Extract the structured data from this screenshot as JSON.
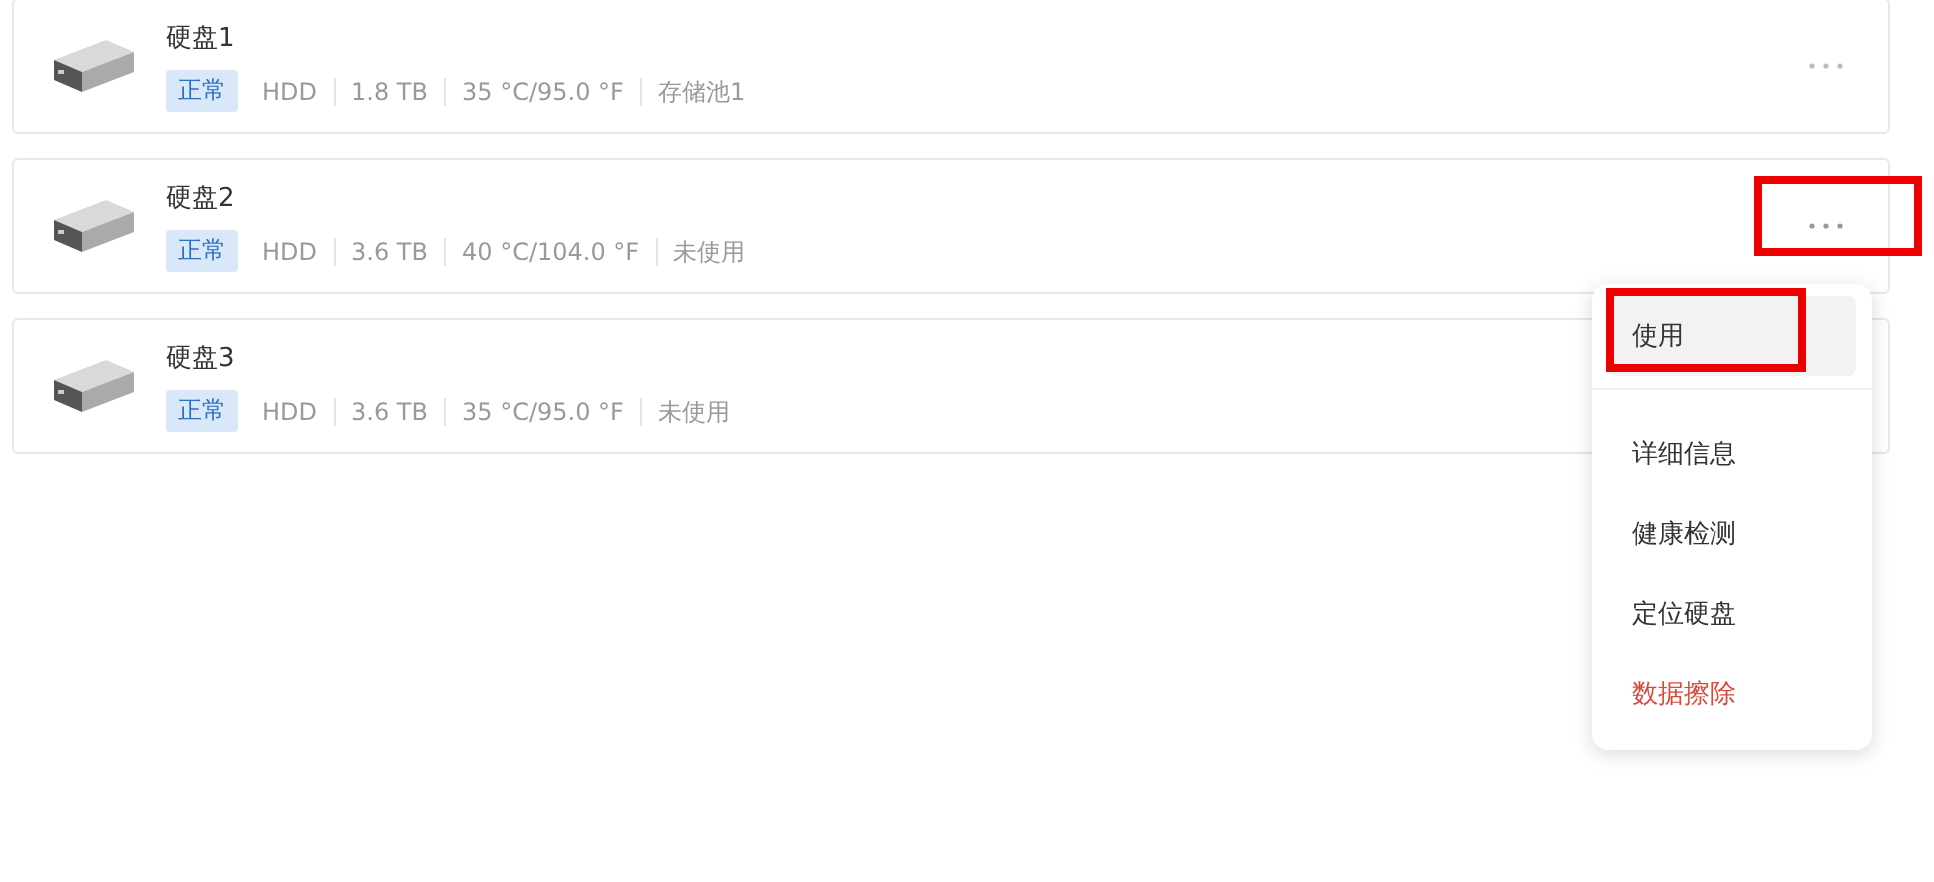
{
  "disks": [
    {
      "name": "硬盘1",
      "status": "正常",
      "type": "HDD",
      "capacity": "1.8 TB",
      "temperature": "35 °C/95.0 °F",
      "usage": "存储池1",
      "menu_open": false,
      "annotated": false
    },
    {
      "name": "硬盘2",
      "status": "正常",
      "type": "HDD",
      "capacity": "3.6 TB",
      "temperature": "40 °C/104.0 °F",
      "usage": "未使用",
      "menu_open": true,
      "annotated": true
    },
    {
      "name": "硬盘3",
      "status": "正常",
      "type": "HDD",
      "capacity": "3.6 TB",
      "temperature": "35 °C/95.0 °F",
      "usage": "未使用",
      "menu_open": false,
      "annotated": false
    }
  ],
  "menu": {
    "groups": [
      {
        "items": [
          {
            "label": "使用",
            "kind": "normal",
            "hovered": true,
            "annotated": true
          }
        ]
      },
      {
        "items": [
          {
            "label": "详细信息",
            "kind": "normal",
            "hovered": false,
            "annotated": false
          },
          {
            "label": "健康检测",
            "kind": "normal",
            "hovered": false,
            "annotated": false
          },
          {
            "label": "定位硬盘",
            "kind": "normal",
            "hovered": false,
            "annotated": false
          },
          {
            "label": "数据擦除",
            "kind": "danger",
            "hovered": false,
            "annotated": false
          }
        ]
      }
    ]
  }
}
